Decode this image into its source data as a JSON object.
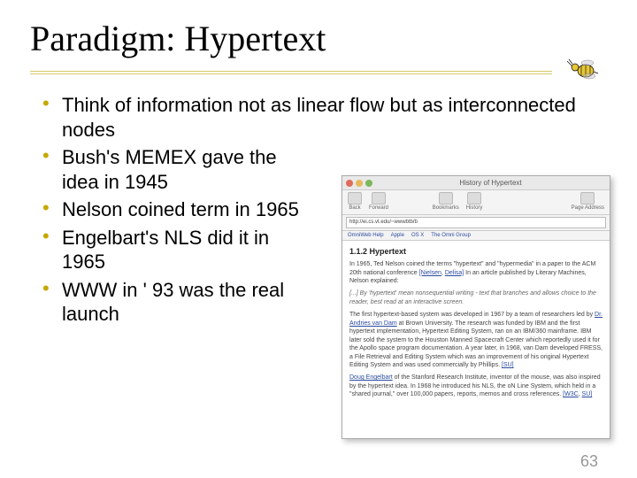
{
  "title": "Paradigm: Hypertext",
  "bullets": [
    "Think of information not as linear flow but as interconnected nodes",
    "Bush's MEMEX gave the idea in 1945",
    "Nelson coined term in 1965",
    "Engelbart's NLS did it in 1965",
    "WWW in ' 93 was the real launch"
  ],
  "page_number": "63",
  "figure": {
    "window_title": "History of Hypertext",
    "toolbar": {
      "back": "Back",
      "forward": "Forward",
      "bookmarks": "Bookmarks",
      "history": "History",
      "page_address": "Page Address"
    },
    "url": "http://ei.cs.vt.edu/~wwwbtb/b",
    "favorites": [
      "OmniWeb Help",
      "Apple",
      "OS X",
      "The Omni Group"
    ],
    "heading": "1.1.2 Hypertext",
    "para1_a": "In 1965, Ted Nelson coined the terms \"hypertext\" and \"hypermedia\" in a paper to the ACM 20th national conference ",
    "link_nielsen": "[Nielsen",
    "link_delisa": "Delisa]",
    "para1_b": " In an article published by Literary Machines, Nelson explained:",
    "quote": "[...] By 'hypertext' mean nonsequential writing - text that branches and allows choice to the reader, best read at an interactive screen.",
    "para2_a": "The first hypertext-based system was developed in 1967 by a team of researchers led by ",
    "link_van_dam": "Dr. Andries van Dam",
    "para2_b": " at Brown University. The research was funded by IBM and the first hypertext implementation, Hypertext Editing System, ran on an IBM/360 mainframe. IBM later sold the system to the Houston Manned Spacecraft Center which reportedly used it for the Apollo space program documentation. A year later, in 1968, van Dam developed FRESS, a File Retrieval and Editing System which was an improvement of his original Hypertext Editing System and was used commercially by Phillips. ",
    "link_su": "[SU]",
    "para3_a": "",
    "link_engelbart": "Doug Engelbart",
    "para3_b": " of the Stanford Research Institute, inventor of the mouse, was also inspired by the hypertext idea. In 1968 he introduced his NLS, the oN Line System, which held in a \"shared journal,\" over 100,000 papers, reports, memos and cross references. ",
    "link_w3c": "[W3C",
    "link_su2": "SU]"
  }
}
